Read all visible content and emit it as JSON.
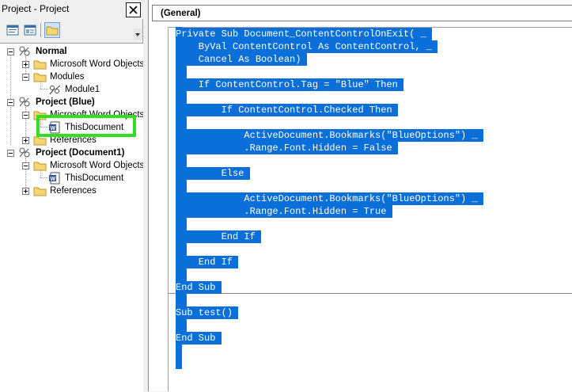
{
  "project_pane": {
    "title": "Project - Project",
    "close_label": "✕",
    "toolbar": [
      "view-code",
      "view-object",
      "toggle-folders"
    ],
    "tree": {
      "normal": {
        "label": "Normal",
        "children": [
          "Microsoft Word Objects",
          "Modules"
        ],
        "module": "Module1"
      },
      "blue": {
        "label": "Project (Blue)",
        "word_objects": "Microsoft Word Objects",
        "document": "ThisDocument",
        "references": "References"
      },
      "doc1": {
        "label": "Project (Document1)",
        "word_objects": "Microsoft Word Objects",
        "document": "ThisDocument",
        "references": "References"
      }
    }
  },
  "code_window": {
    "object_combo": "(General)",
    "selection_color": "#0a6fd8",
    "lines": [
      "Private Sub Document_ContentControlOnExit( _",
      "    ByVal ContentControl As ContentControl, _",
      "    Cancel As Boolean)",
      "",
      "    If ContentControl.Tag = \"Blue\" Then",
      "",
      "        If ContentControl.Checked Then",
      "",
      "            ActiveDocument.Bookmarks(\"BlueOptions\") _",
      "            .Range.Font.Hidden = False",
      "",
      "        Else",
      "",
      "            ActiveDocument.Bookmarks(\"BlueOptions\") _",
      "            .Range.Font.Hidden = True",
      "",
      "        End If",
      "",
      "    End If",
      "",
      "End Sub",
      "",
      "Sub test()",
      "",
      "End Sub"
    ]
  },
  "highlight_color": "#33dd22"
}
